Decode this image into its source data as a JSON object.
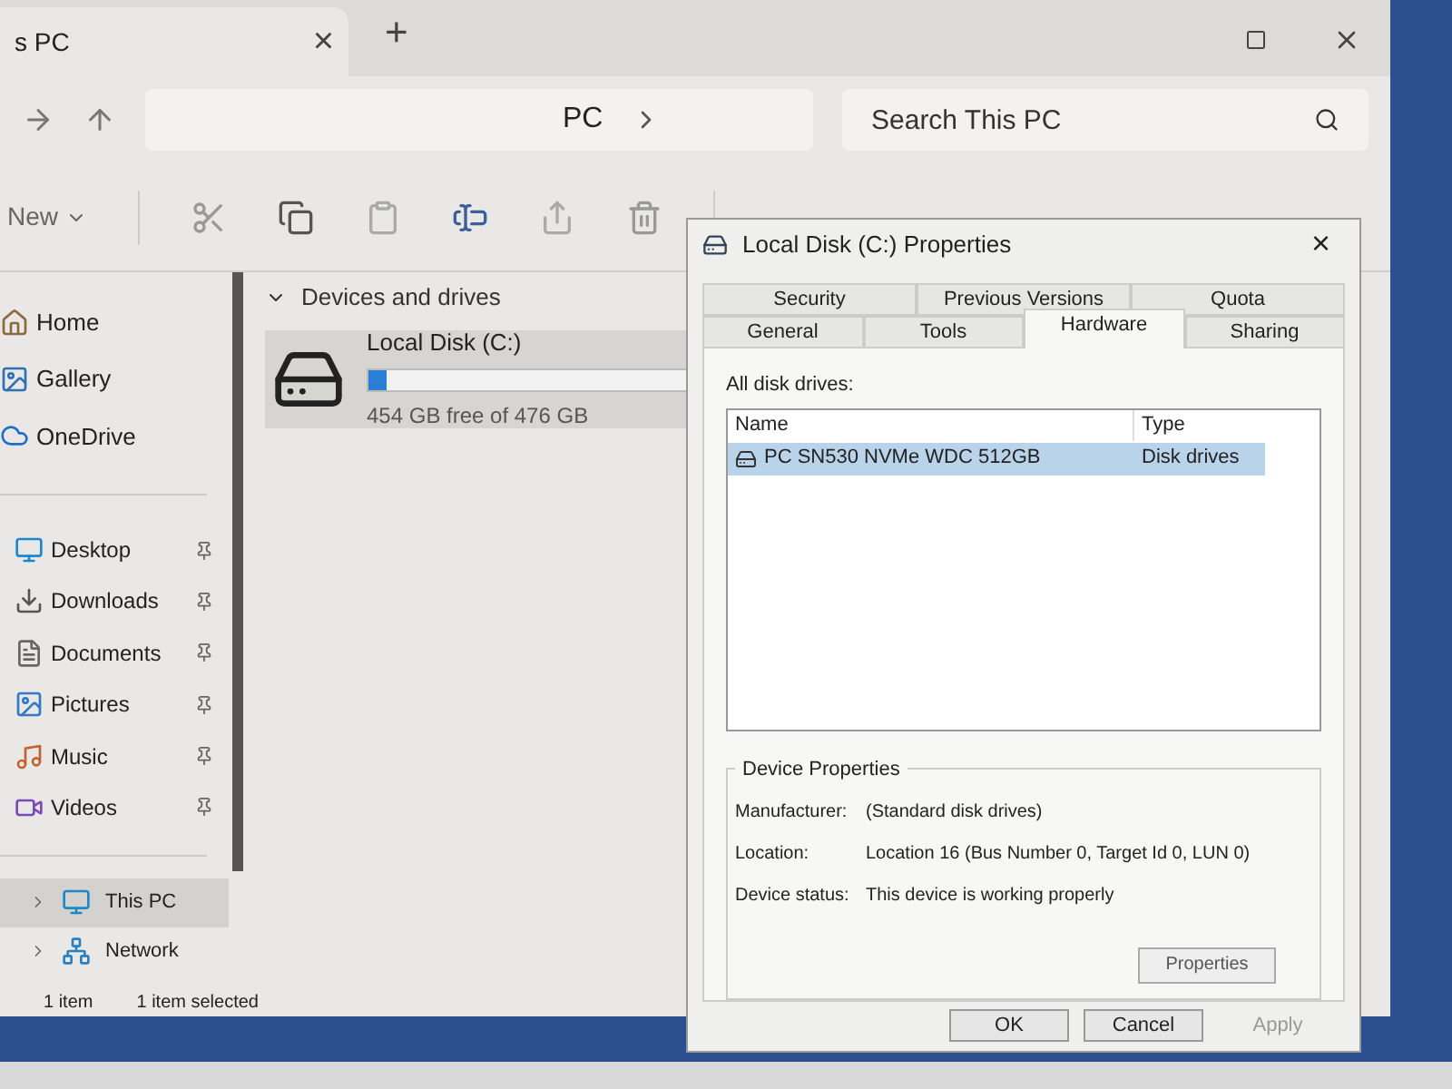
{
  "explorer": {
    "tab": {
      "title": "s PC",
      "close": "×"
    },
    "new_tab": "+",
    "breadcrumb": [
      "PC"
    ],
    "search": {
      "placeholder": "Search This PC"
    },
    "toolbar": {
      "new": "New"
    },
    "sidebar": {
      "top": [
        {
          "label": "Home",
          "selected": false
        },
        {
          "label": "Gallery",
          "selected": false
        },
        {
          "label": "OneDrive",
          "selected": false
        }
      ],
      "pinned": [
        {
          "label": "Desktop"
        },
        {
          "label": "Downloads"
        },
        {
          "label": "Documents"
        },
        {
          "label": "Pictures"
        },
        {
          "label": "Music"
        },
        {
          "label": "Videos"
        }
      ],
      "bottom": [
        {
          "label": "This PC",
          "selected": true
        },
        {
          "label": "Network",
          "selected": false
        }
      ]
    },
    "group": {
      "title": "Devices and drives",
      "expanded": true
    },
    "drives": [
      {
        "name": "Local Disk (C:)",
        "free": "454 GB free of 476 GB",
        "level": 0.05,
        "selected": true
      }
    ],
    "status_bar": [
      "1 item",
      "1 item selected"
    ]
  },
  "dialog": {
    "title": "Local Disk (C:) Properties",
    "close": "×",
    "tab_rows": [
      [
        {
          "label": "Security",
          "selected": false
        },
        {
          "label": "Previous Versions",
          "selected": false
        },
        {
          "label": "Quota",
          "selected": false
        }
      ],
      [
        {
          "label": "General",
          "selected": false
        },
        {
          "label": "Tools",
          "selected": false
        },
        {
          "label": "Hardware",
          "selected": true
        },
        {
          "label": "Sharing",
          "selected": false
        }
      ]
    ],
    "list_label": "All disk drives:",
    "columns": [
      "Name",
      "Type"
    ],
    "rows": [
      {
        "name": "PC SN530 NVMe WDC 512GB",
        "type": "Disk drives",
        "selected": true
      }
    ],
    "device_properties": {
      "title": "Device Properties",
      "fields": [
        {
          "label": "Manufacturer:",
          "value": "(Standard disk drives)"
        },
        {
          "label": "Location:",
          "value": "Location 16 (Bus Number 0, Target Id 0, LUN 0)"
        },
        {
          "label": "Device status:",
          "value": "This device is working properly"
        }
      ],
      "button": "Properties"
    },
    "buttons": [
      {
        "label": "OK",
        "disabled": false
      },
      {
        "label": "Cancel",
        "disabled": false
      },
      {
        "label": "Apply",
        "disabled": true
      }
    ]
  }
}
